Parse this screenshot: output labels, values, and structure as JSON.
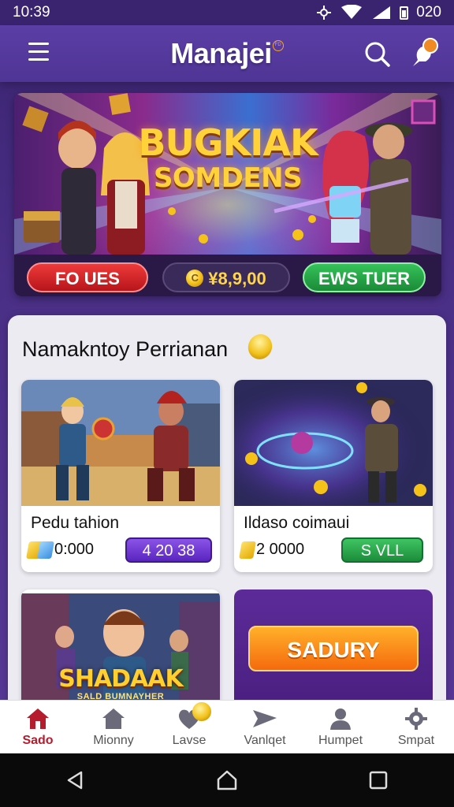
{
  "status_bar": {
    "time": "10:39",
    "right_text": "020",
    "icons": [
      "settings-status-icon",
      "signal-icon",
      "battery-icon"
    ]
  },
  "app_bar": {
    "title": "Manajei",
    "title_badge": "FD",
    "icons": [
      "menu-icon",
      "search-icon",
      "bell-icon"
    ]
  },
  "banner": {
    "title_line1": "BUGKIAK",
    "title_line2": "SOMDENS",
    "left_button": "FO UES",
    "balance": "¥8,9,00",
    "right_button": "EWS TUER"
  },
  "section": {
    "title": "Namakntoy Perrianan"
  },
  "games": [
    {
      "title": "Pedu tahion",
      "price": "0:000",
      "button": "4 20 38"
    },
    {
      "title": "Ildaso coimaui",
      "price": "2 0000",
      "button": "S VLL"
    }
  ],
  "bottom_cards": {
    "left_art_title": "SHADAAK",
    "left_art_subtitle": "SALD BUMNAYHER",
    "promo_button": "SADURY"
  },
  "bottom_nav": {
    "items": [
      {
        "label": "Sado",
        "icon": "home-icon",
        "active": true
      },
      {
        "label": "Mionny",
        "icon": "house-icon",
        "active": false
      },
      {
        "label": "Lavse",
        "icon": "heart-icon",
        "active": false
      },
      {
        "label": "Vanlqet",
        "icon": "send-icon",
        "active": false
      },
      {
        "label": "Humpet",
        "icon": "person-icon",
        "active": false
      },
      {
        "label": "Smpat",
        "icon": "gear-icon",
        "active": false
      }
    ]
  },
  "colors": {
    "accent_purple": "#4f3595",
    "active_red": "#b51d2e",
    "coin_gold": "#f2c11a"
  }
}
